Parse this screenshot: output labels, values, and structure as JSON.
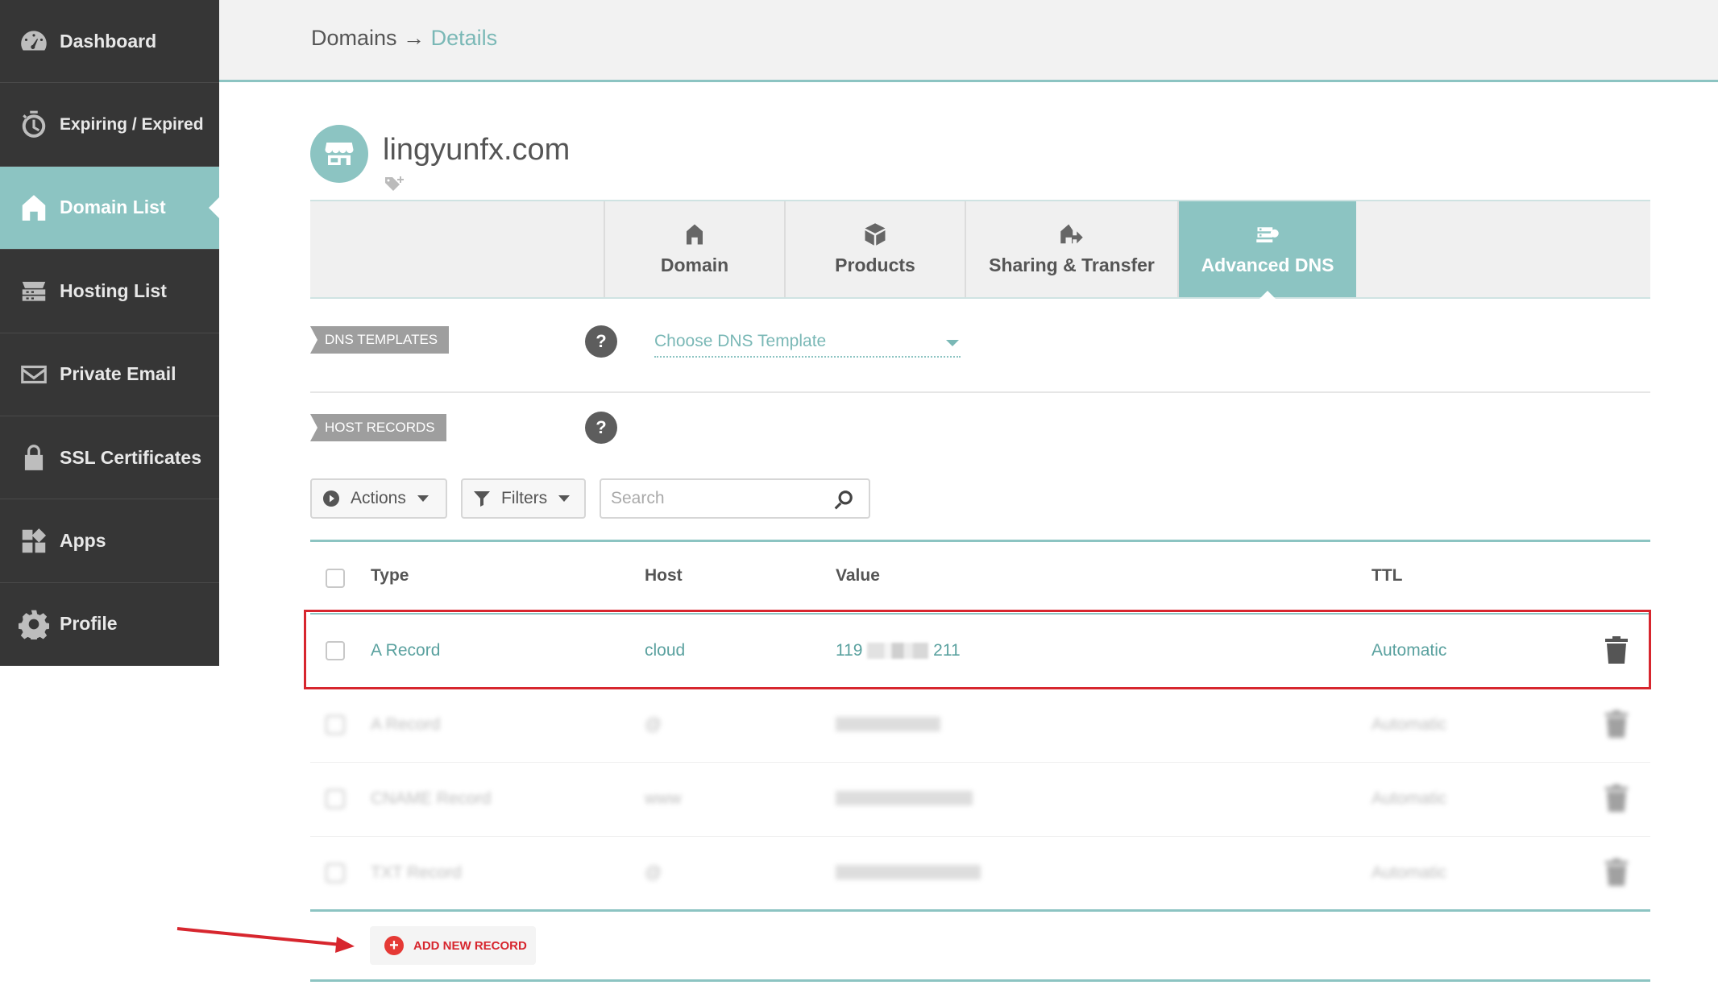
{
  "sidebar": {
    "items": [
      {
        "label": "Dashboard",
        "icon": "speedometer-icon"
      },
      {
        "label": "Expiring / Expired",
        "icon": "timer-icon"
      },
      {
        "label": "Domain List",
        "icon": "home-icon",
        "active": true
      },
      {
        "label": "Hosting List",
        "icon": "server-icon"
      },
      {
        "label": "Private Email",
        "icon": "envelope-icon"
      },
      {
        "label": "SSL Certificates",
        "icon": "lock-icon"
      },
      {
        "label": "Apps",
        "icon": "apps-grid-icon"
      },
      {
        "label": "Profile",
        "icon": "gear-icon"
      }
    ]
  },
  "breadcrumb": {
    "parent": "Domains",
    "separator": "→",
    "current": "Details"
  },
  "domain": {
    "name": "lingyunfx.com"
  },
  "tabs": [
    {
      "label": "Domain",
      "icon": "home-icon"
    },
    {
      "label": "Products",
      "icon": "box-icon"
    },
    {
      "label": "Sharing & Transfer",
      "icon": "transfer-house-icon"
    },
    {
      "label": "Advanced DNS",
      "icon": "dns-server-icon",
      "active": true
    }
  ],
  "dns_templates": {
    "label": "DNS TEMPLATES",
    "help": "?",
    "select_value": "Choose DNS Template"
  },
  "host_records": {
    "label": "HOST RECORDS",
    "help": "?"
  },
  "toolbar": {
    "actions_label": "Actions",
    "filters_label": "Filters",
    "search_placeholder": "Search"
  },
  "table": {
    "headers": {
      "type": "Type",
      "host": "Host",
      "value": "Value",
      "ttl": "TTL"
    },
    "rows": [
      {
        "type": "A Record",
        "host": "cloud",
        "value_start": "119",
        "value_end": "211",
        "ttl": "Automatic",
        "highlighted": true
      },
      {
        "type": "A Record",
        "host": "@",
        "value": "",
        "ttl": "Automatic",
        "blurred": true
      },
      {
        "type": "CNAME Record",
        "host": "www",
        "value": "",
        "ttl": "Automatic",
        "blurred": true
      },
      {
        "type": "TXT Record",
        "host": "@",
        "value": "",
        "ttl": "Automatic",
        "blurred": true
      }
    ]
  },
  "add_record": {
    "label": "ADD NEW RECORD"
  },
  "colors": {
    "accent": "#8cc4c2",
    "sidebar": "#363636",
    "highlight": "#d7262e",
    "link": "#5aa19f"
  }
}
